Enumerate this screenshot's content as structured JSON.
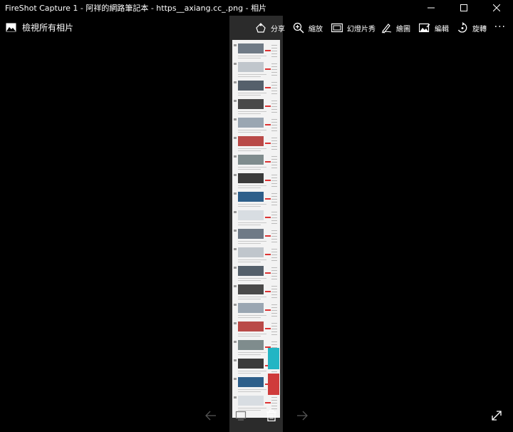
{
  "window": {
    "title": "FireShot Capture 1 - 阿祥的網路筆記本 - https__axiang.cc_.png - 相片"
  },
  "toolbar": {
    "all_photos_label": "檢視所有相片",
    "share_label": "分享",
    "zoom_label": "縮放",
    "slideshow_label": "幻燈片秀",
    "draw_label": "繪圖",
    "edit_label": "編輯",
    "rotate_label": "旋轉",
    "more_label": "···"
  },
  "colors": {
    "background": "#000000",
    "foreground": "#ffffff",
    "disabled": "#555555"
  },
  "icons": [
    "photos-icon",
    "share-icon",
    "zoom-icon",
    "slideshow-icon",
    "draw-icon",
    "edit-icon",
    "rotate-icon",
    "more-icon",
    "back-arrow-icon",
    "forward-arrow-icon",
    "filmstrip-icon",
    "delete-icon",
    "fullscreen-icon",
    "minimize-icon",
    "maximize-icon",
    "close-icon"
  ]
}
